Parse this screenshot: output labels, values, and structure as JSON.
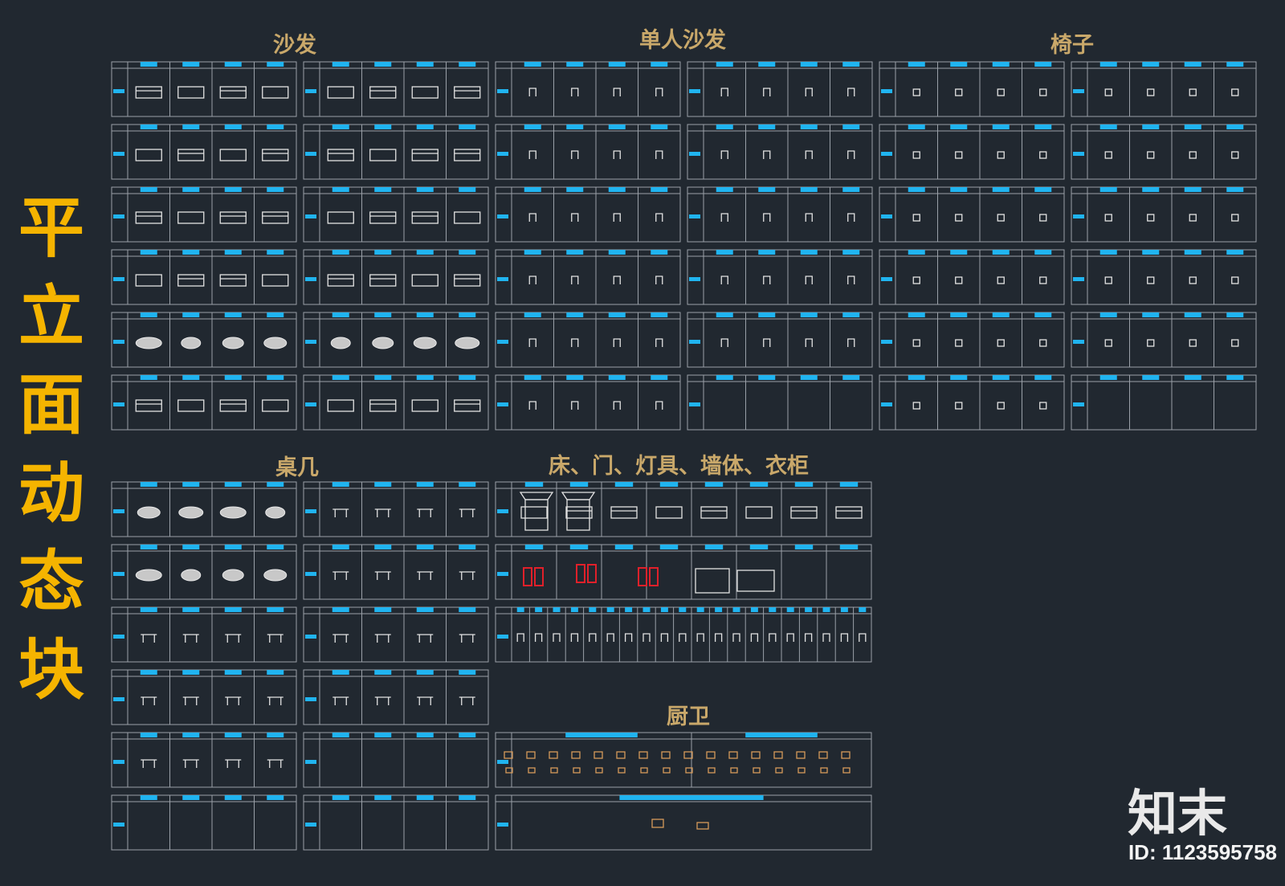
{
  "vertical_title": [
    "平",
    "立",
    "面",
    "动",
    "态",
    "块"
  ],
  "section_titles": {
    "sofa": "沙发",
    "single_sofa": "单人沙发",
    "chair": "椅子",
    "table": "桌几",
    "bed_door_lamp": "床、门、灯具、墙体、衣柜",
    "kitchen_bath": "厨卫"
  },
  "brand": {
    "logo_text": "知末",
    "image_id": "ID: 1123595758"
  },
  "colors": {
    "background": "#212830",
    "title_yellow": "#f5b400",
    "section_title": "#c9a86a",
    "header_cyan": "#20b4f0",
    "grid_line": "#9aa0a8",
    "symbol": "#e3e3e3",
    "door_red": "#e0202a",
    "kitchen_orange": "#d69a5a"
  }
}
